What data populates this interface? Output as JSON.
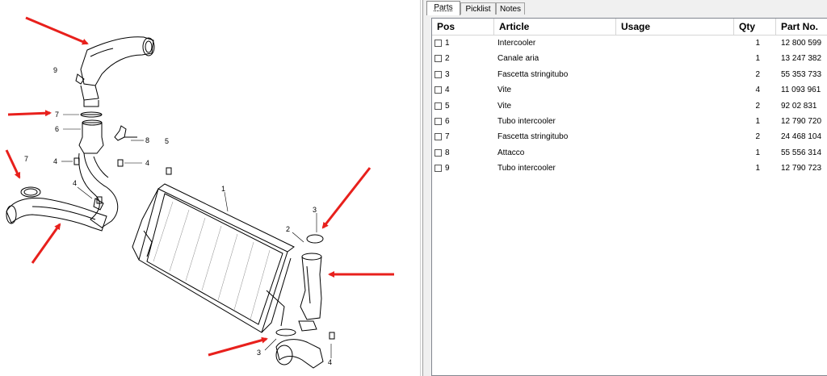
{
  "tabs": [
    {
      "label": "Parts",
      "active": true
    },
    {
      "label": "Picklist",
      "active": false
    },
    {
      "label": "Notes",
      "active": false
    }
  ],
  "table": {
    "columns": [
      "Pos",
      "Article",
      "Usage",
      "Qty",
      "Part No."
    ],
    "rows": [
      {
        "pos": "1",
        "article": "Intercooler",
        "usage": "",
        "qty": "1",
        "part_no": "12 800 599"
      },
      {
        "pos": "2",
        "article": "Canale aria",
        "usage": "",
        "qty": "1",
        "part_no": "13 247 382"
      },
      {
        "pos": "3",
        "article": "Fascetta stringitubo",
        "usage": "",
        "qty": "2",
        "part_no": "55 353 733"
      },
      {
        "pos": "4",
        "article": "Vite",
        "usage": "",
        "qty": "4",
        "part_no": "11 093 961"
      },
      {
        "pos": "5",
        "article": "Vite",
        "usage": "",
        "qty": "2",
        "part_no": "92 02 831"
      },
      {
        "pos": "6",
        "article": "Tubo intercooler",
        "usage": "",
        "qty": "1",
        "part_no": "12 790 720"
      },
      {
        "pos": "7",
        "article": "Fascetta stringitubo",
        "usage": "",
        "qty": "2",
        "part_no": "24 468 104"
      },
      {
        "pos": "8",
        "article": "Attacco",
        "usage": "",
        "qty": "1",
        "part_no": "55 556 314"
      },
      {
        "pos": "9",
        "article": "Tubo intercooler",
        "usage": "",
        "qty": "1",
        "part_no": "12 790 723"
      }
    ]
  },
  "diagram": {
    "callouts": [
      "9",
      "7",
      "6",
      "8",
      "5",
      "4",
      "4",
      "7",
      "4",
      "1",
      "3",
      "2",
      "3",
      "4"
    ],
    "arrow_color": "#e8201c"
  }
}
